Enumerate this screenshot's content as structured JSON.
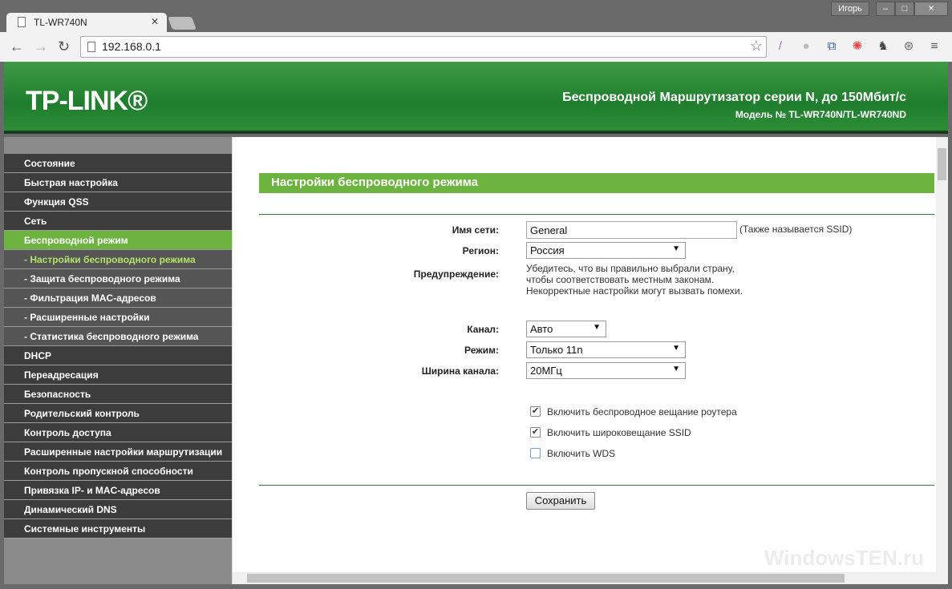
{
  "browser": {
    "tab_title": "TL-WR740N",
    "user": "Игорь",
    "url": "192.168.0.1"
  },
  "header": {
    "logo": "TP-LINK®",
    "title": "Беспроводной Маршрутизатор серии N, до 150Мбит/с",
    "model": "Модель № TL-WR740N/TL-WR740ND"
  },
  "sidebar": {
    "items": [
      {
        "label": "Состояние",
        "type": "main"
      },
      {
        "label": "Быстрая настройка",
        "type": "main"
      },
      {
        "label": "Функция QSS",
        "type": "main"
      },
      {
        "label": "Сеть",
        "type": "main"
      },
      {
        "label": "Беспроводной режим",
        "type": "active"
      },
      {
        "label": "- Настройки беспроводного режима",
        "type": "subact"
      },
      {
        "label": "- Защита беспроводного режима",
        "type": "sub"
      },
      {
        "label": "- Фильтрация MAC-адресов",
        "type": "sub"
      },
      {
        "label": "- Расширенные настройки",
        "type": "sub"
      },
      {
        "label": "- Статистика беспроводного режима",
        "type": "sub"
      },
      {
        "label": "DHCP",
        "type": "main"
      },
      {
        "label": "Переадресация",
        "type": "main"
      },
      {
        "label": "Безопасность",
        "type": "main"
      },
      {
        "label": "Родительский контроль",
        "type": "main"
      },
      {
        "label": "Контроль доступа",
        "type": "main"
      },
      {
        "label": "Расширенные настройки маршрутизации",
        "type": "main"
      },
      {
        "label": "Контроль пропускной способности",
        "type": "main"
      },
      {
        "label": "Привязка IP- и MAC-адресов",
        "type": "main"
      },
      {
        "label": "Динамический DNS",
        "type": "main"
      },
      {
        "label": "Системные инструменты",
        "type": "main"
      }
    ]
  },
  "form": {
    "title": "Настройки беспроводного режима",
    "ssid_label": "Имя сети:",
    "ssid_value": "General",
    "ssid_note": "(Также называется SSID)",
    "region_label": "Регион:",
    "region_value": "Россия",
    "warning_label": "Предупреждение:",
    "warning_lines": [
      "Убедитесь, что вы правильно выбрали страну,",
      "чтобы соответствовать местным законам.",
      "Некорректные настройки могут вызвать помехи."
    ],
    "channel_label": "Канал:",
    "channel_value": "Авто",
    "mode_label": "Режим:",
    "mode_value": "Только 11n",
    "width_label": "Ширина канала:",
    "width_value": "20МГц",
    "checkboxes": [
      {
        "label": "Включить беспроводное вещание роутера",
        "checked": true
      },
      {
        "label": "Включить широковещание SSID",
        "checked": true
      },
      {
        "label": "Включить WDS",
        "checked": false
      }
    ],
    "save": "Сохранить"
  },
  "watermark": "WindowsTEN.ru"
}
